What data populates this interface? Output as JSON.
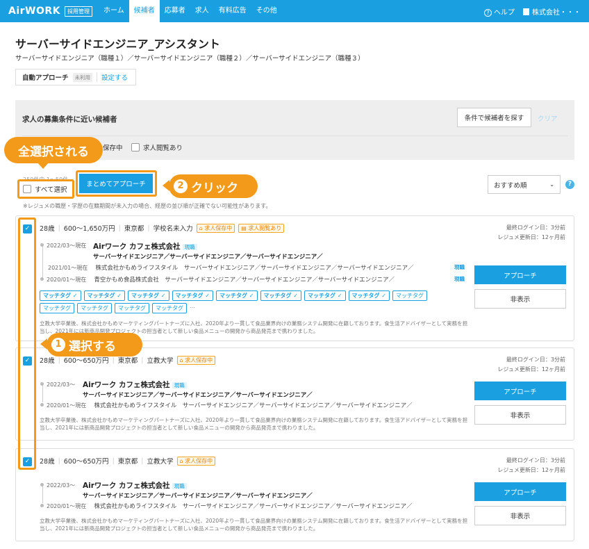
{
  "header": {
    "logo": "AirWORK",
    "logo_badge": "採用管理",
    "nav": [
      "ホーム",
      "候補者",
      "応募者",
      "求人",
      "有料広告",
      "その他"
    ],
    "active_nav": "候補者",
    "help": "ヘルプ",
    "company": "株式会社・・・"
  },
  "page": {
    "title": "サーバーサイドエンジニア_アシスタント",
    "subtitle": "サーバーサイドエンジニア（職種１）／サーバーサイドエンジニア（職種２）／サーバーサイドエンジニア（職種３）",
    "auto_approach_label": "自動アプローチ",
    "auto_approach_status": "未利用",
    "auto_approach_link": "設定する"
  },
  "search": {
    "title": "求人の募集条件に近い候補者",
    "search_button": "条件で候補者を探す",
    "clear": "クリア",
    "chk_saved": "保存中",
    "chk_viewed": "求人閲覧あり"
  },
  "list": {
    "count": "250件中 1〜50件",
    "select_all": "すべて選択",
    "bulk_button": "まとめてアプローチ",
    "note": "※レジュメの職歴・学歴の在籍期間が未入力の場合、経歴の並び順が正確でない可能性があります。",
    "sort": "おすすめ順",
    "help_mark": "?"
  },
  "annotations": {
    "select_all_callout": "全選択される",
    "click_num": "2",
    "click_text": "クリック",
    "select_num": "1",
    "select_text": "選択する"
  },
  "cards": [
    {
      "age": "28歳",
      "salary": "600〜1,650万円",
      "location": "東京都",
      "school": "学校名未入力",
      "badges": [
        "求人保存中",
        "求人閲覧あり"
      ],
      "last_login": "最終ログイン日：3分前",
      "resume_updated": "レジュメ更新日：12ヶ月前",
      "career1_date": "2022/03〜現在",
      "career1_company": "Airワーク カフェ株式会社",
      "career1_current": "現職",
      "career1_roles": "サーバーサイドエンジニア／サーバーサイドエンジニア／サーバーサイドエンジニア／",
      "career2_date": "2021/01〜現在",
      "career2_text": "株式会社かもめライフスタイル　サーバーサイドエンジニア／サーバーサイドエンジニア／サーバーサイドエンジニア／",
      "career2_tag": "現職",
      "career3_date": "2020/01〜現在",
      "career3_text": "青空かもめ食品株式会社　サーバーサイドエンジニア／サーバーサイドエンジニア／サーバーサイドエンジニア／",
      "career3_tag": "現職",
      "tags": [
        "マッチタグ ✓",
        "マッチタグ ✓",
        "マッチタグ ✓",
        "マッチタグ ✓",
        "マッチタグ ✓",
        "マッチタグ ✓",
        "マッチタグ ✓",
        "マッチタグ ✓",
        "マッチタグ",
        "マッチタグ",
        "マッチタグ",
        "マッチタグ",
        "マッチタグ"
      ],
      "tags_more": "…",
      "desc": "立教大学卒業後、株式会社かもめマーケティングパートナーズに入社、2020年より一貫して食品業界向けの業務システム開発に在籍しております。食生活アドバイザーとして実務を担当し、2021年には新商品開発プロジェクトの担当者として新しい食品メニューの開発から商品発売まで携わりました。",
      "approach": "アプローチ",
      "hide": "非表示"
    },
    {
      "age": "28歳",
      "salary": "600〜650万円",
      "location": "東京都",
      "school": "立教大学",
      "badges": [
        "求人保存中"
      ],
      "last_login": "最終ログイン日：3分前",
      "resume_updated": "レジュメ更新日：12ヶ月前",
      "career1_date": "2022/03〜",
      "career1_company": "Airワーク カフェ株式会社",
      "career1_current": "現職",
      "career1_roles": "サーバーサイドエンジニア／サーバーサイドエンジニア／サーバーサイドエンジニア／",
      "career2_date": "2020/01〜現在",
      "career2_text": "株式会社かもめライフスタイル　サーバーサイドエンジニア／サーバーサイドエンジニア／サーバーサイドエンジニア／",
      "desc": "立教大学卒業後、株式会社かもめマーケティングパートナーズに入社、2020年より一貫して食品業界向けの業務システム開発に在籍しております。食生活アドバイザーとして実務を担当し、2021年には新商品開発プロジェクトの担当者として新しい食品メニューの開発から商品発売まで携わりました。",
      "approach": "アプローチ",
      "hide": "非表示"
    },
    {
      "age": "28歳",
      "salary": "600〜650万円",
      "location": "東京都",
      "school": "立教大学",
      "badges": [
        "求人保存中"
      ],
      "last_login": "最終ログイン日：3分前",
      "resume_updated": "レジュメ更新日：12ヶ月前",
      "career1_date": "2022/03〜",
      "career1_company": "Airワーク カフェ株式会社",
      "career1_current": "現職",
      "career1_roles": "サーバーサイドエンジニア／サーバーサイドエンジニア／サーバーサイドエンジニア／",
      "career2_date": "2020/01〜現在",
      "career2_text": "株式会社かもめライフスタイル　サーバーサイドエンジニア／サーバーサイドエンジニア／サーバーサイドエンジニア／",
      "desc": "立教大学卒業後、株式会社かもめマーケティングパートナーズに入社、2020年より一貫して食品業界向けの業務システム開発に在籍しております。食生活アドバイザーとして実務を担当し、2021年には新商品開発プロジェクトの担当者として新しい食品メニューの開発から商品発売まで携わりました。",
      "approach": "アプローチ",
      "hide": "非表示"
    }
  ],
  "colors": {
    "brand": "#1aa0e0",
    "annotation": "#f49a1a",
    "badge_orange": "#e8850c"
  }
}
